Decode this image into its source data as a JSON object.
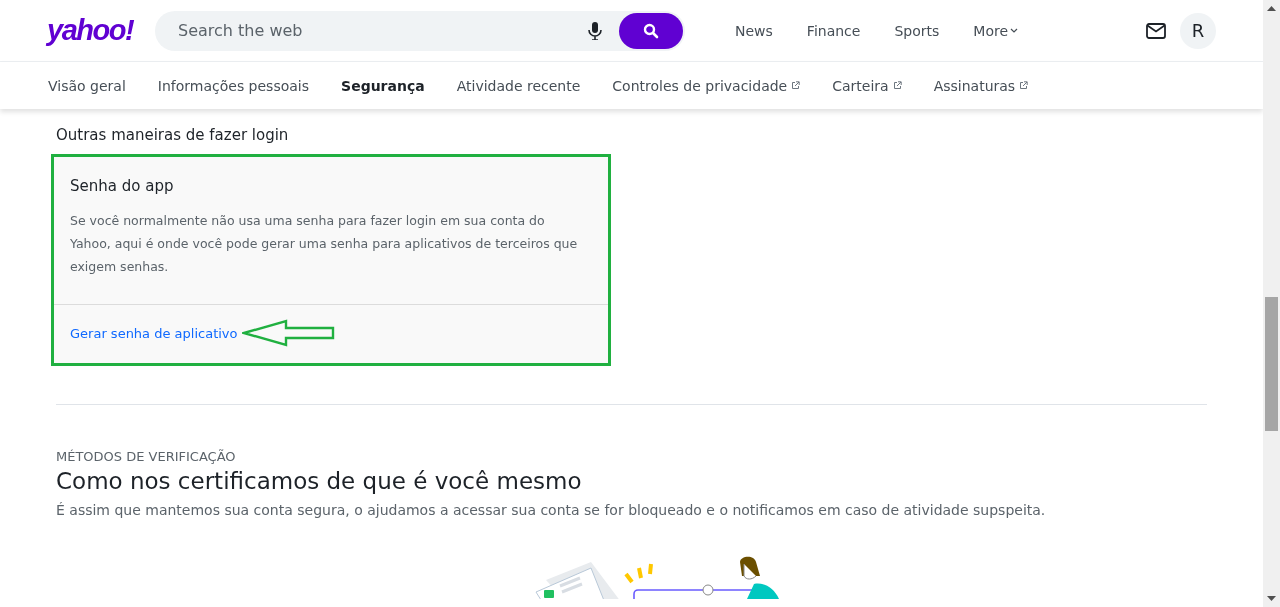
{
  "header": {
    "logo": "yahoo!",
    "search": {
      "placeholder": "Search the web"
    },
    "links": [
      {
        "label": "News",
        "dropdown": false
      },
      {
        "label": "Finance",
        "dropdown": false
      },
      {
        "label": "Sports",
        "dropdown": false
      },
      {
        "label": "More",
        "dropdown": true
      }
    ],
    "avatar": "R"
  },
  "tabs": [
    {
      "label": "Visão geral",
      "selected": false,
      "external": false
    },
    {
      "label": "Informações pessoais",
      "selected": false,
      "external": false
    },
    {
      "label": "Segurança",
      "selected": true,
      "external": false
    },
    {
      "label": "Atividade recente",
      "selected": false,
      "external": false
    },
    {
      "label": "Controles de privacidade",
      "selected": false,
      "external": true
    },
    {
      "label": "Carteira",
      "selected": false,
      "external": true
    },
    {
      "label": "Assinaturas",
      "selected": false,
      "external": true
    }
  ],
  "other_logins": {
    "title": "Outras maneiras de fazer login",
    "card": {
      "title": "Senha do app",
      "description": "Se você normalmente não usa uma senha para fazer login em sua conta do Yahoo, aqui é onde você pode gerar uma senha para aplicativos de terceiros que exigem senhas.",
      "link": "Gerar senha de aplicativo"
    }
  },
  "verification": {
    "eyebrow": "MÉTODOS DE VERIFICAÇÃO",
    "title": "Como nos certificamos de que é você mesmo",
    "description": "É assim que mantemos sua conta segura, o ajudamos a acessar sua conta se for bloqueado e o notificamos em caso de atividade supspeita."
  }
}
